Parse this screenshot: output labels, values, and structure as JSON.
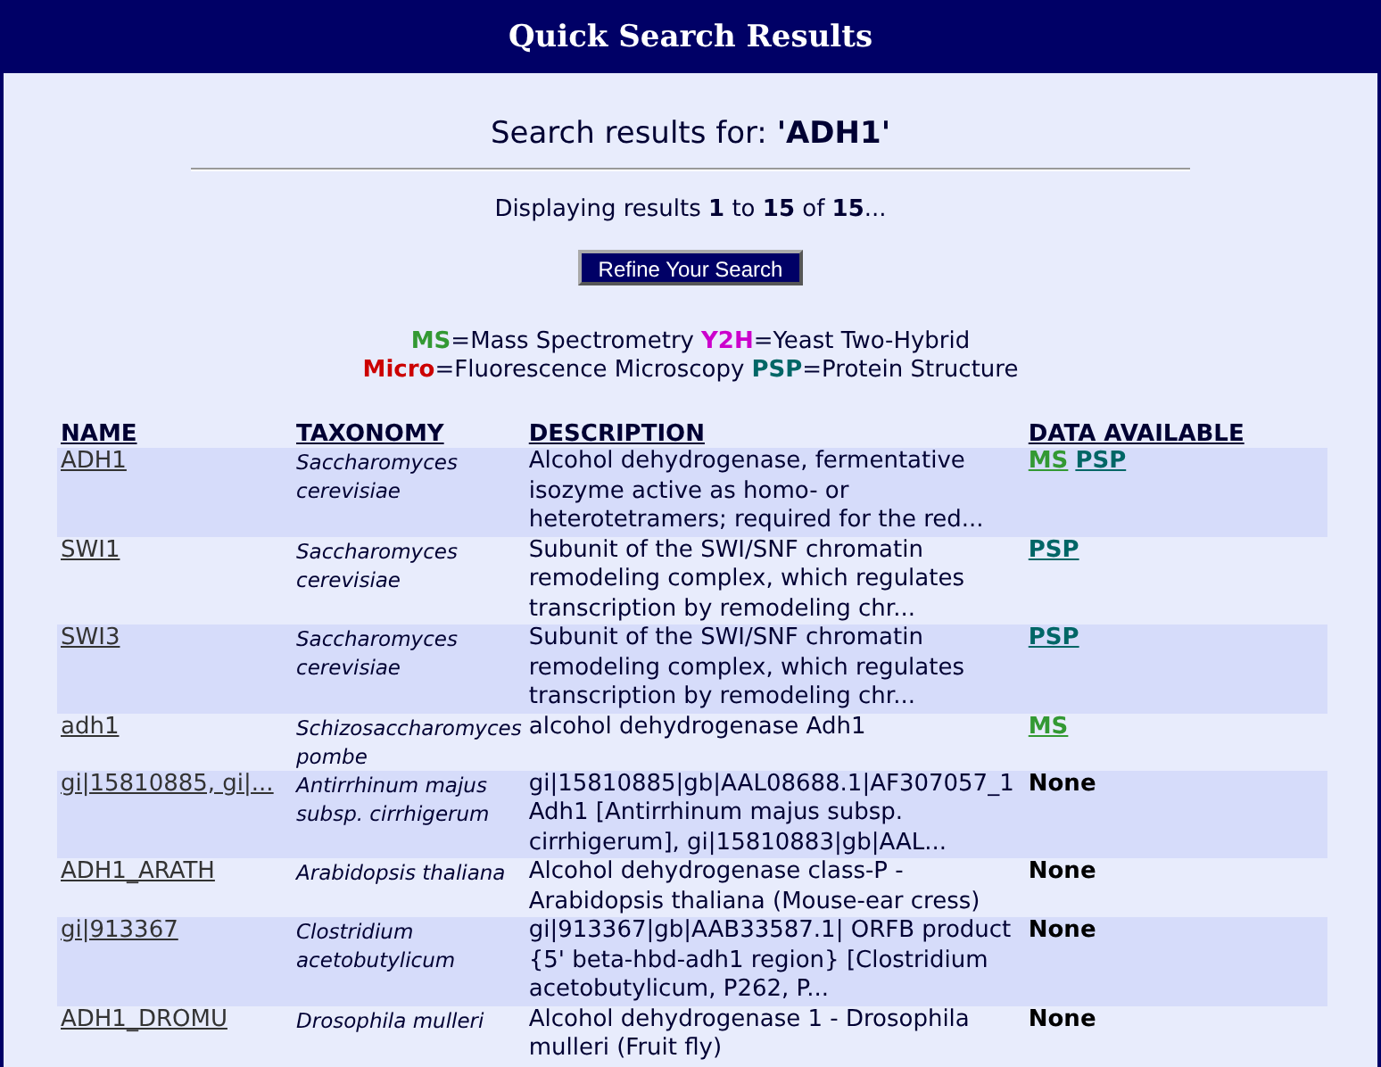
{
  "header": {
    "title": "Quick Search Results"
  },
  "search": {
    "label": "Search results for:",
    "query": "'ADH1'"
  },
  "paging": {
    "text": "Displaying results **1** to **15** of **15**..."
  },
  "refine_button": {
    "label": "Refine Your Search"
  },
  "legend": [
    [
      {
        "tag": "MS",
        "color": "#339933",
        "meaning": "=Mass Spectrometry"
      },
      {
        "tag": "Y2H",
        "color": "#cc00cc",
        "meaning": "=Yeast Two-Hybrid"
      }
    ],
    [
      {
        "tag": "Micro",
        "color": "#cc0000",
        "meaning": "=Fluorescence Microscopy"
      },
      {
        "tag": "PSP",
        "color": "#006666",
        "meaning": "=Protein Structure"
      }
    ]
  ],
  "table": {
    "columns": [
      "NAME",
      "TAXONOMY",
      "DESCRIPTION",
      "DATA AVAILABLE"
    ],
    "rows": [
      {
        "name": "ADH1",
        "taxonomy": [
          "Saccharomyces",
          "cerevisiae"
        ],
        "description": [
          "Alcohol dehydrogenase, fermentative",
          "isozyme active as homo- or",
          "heterotetramers; required for the red..."
        ],
        "data": [
          {
            "label": "MS",
            "kind": "link",
            "color": "#339933"
          },
          {
            "label": "PSP",
            "kind": "link",
            "color": "#006666"
          }
        ]
      },
      {
        "name": "SWI1",
        "taxonomy": [
          "Saccharomyces",
          "cerevisiae"
        ],
        "description": [
          "Subunit of the SWI/SNF chromatin",
          "remodeling complex, which regulates",
          "transcription by remodeling chr..."
        ],
        "data": [
          {
            "label": "PSP",
            "kind": "link",
            "color": "#006666"
          }
        ]
      },
      {
        "name": "SWI3",
        "taxonomy": [
          "Saccharomyces",
          "cerevisiae"
        ],
        "description": [
          "Subunit of the SWI/SNF chromatin",
          "remodeling complex, which regulates",
          "transcription by remodeling chr..."
        ],
        "data": [
          {
            "label": "PSP",
            "kind": "link",
            "color": "#006666"
          }
        ]
      },
      {
        "name": "adh1",
        "taxonomy": [
          "Schizosaccharomyces",
          "pombe"
        ],
        "description": [
          "alcohol dehydrogenase Adh1"
        ],
        "data": [
          {
            "label": "MS",
            "kind": "link",
            "color": "#339933"
          }
        ]
      },
      {
        "name": "gi|15810885, gi|...",
        "taxonomy": [
          "Antirrhinum majus",
          "subsp. cirrhigerum"
        ],
        "description": [
          "gi|15810885|gb|AAL08688.1|AF307057_1",
          "Adh1 [Antirrhinum majus subsp.",
          "cirrhigerum], gi|15810883|gb|AAL..."
        ],
        "data": [
          {
            "label": "None",
            "kind": "none"
          }
        ]
      },
      {
        "name": "ADH1_ARATH",
        "taxonomy": [
          "Arabidopsis thaliana"
        ],
        "description": [
          "Alcohol dehydrogenase class-P -",
          "Arabidopsis thaliana (Mouse-ear cress)"
        ],
        "data": [
          {
            "label": "None",
            "kind": "none"
          }
        ]
      },
      {
        "name": "gi|913367",
        "taxonomy": [
          "Clostridium",
          "acetobutylicum"
        ],
        "description": [
          "gi|913367|gb|AAB33587.1| ORFB product",
          "{5' beta-hbd-adh1 region} [Clostridium",
          "acetobutylicum, P262, P..."
        ],
        "data": [
          {
            "label": "None",
            "kind": "none"
          }
        ]
      },
      {
        "name": "ADH1_DROMU",
        "taxonomy": [
          "Drosophila mulleri"
        ],
        "description": [
          "Alcohol dehydrogenase 1 - Drosophila",
          "mulleri (Fruit fly)"
        ],
        "data": [
          {
            "label": "None",
            "kind": "none"
          }
        ]
      }
    ]
  }
}
